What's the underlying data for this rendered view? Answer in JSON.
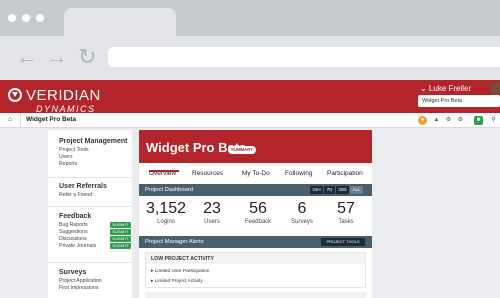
{
  "app": {
    "logo_line1": "VERIDIAN",
    "logo_line2": "DYNAMICS",
    "user_name": "⌄ Luke Freiler",
    "project_selector": "Widget Pro Beta"
  },
  "breadcrumb": {
    "home_icon": "⌂",
    "label": "Widget Pro Beta"
  },
  "toolbar": [
    "●",
    "▲",
    "⚙",
    "⚙",
    "■",
    "⚲"
  ],
  "sidebar": {
    "project_management": {
      "title": "Project Management",
      "items": [
        "Project Tools",
        "Users",
        "Reports"
      ]
    },
    "user_referrals": {
      "title": "User Referrals",
      "items": [
        "Refer a Friend"
      ]
    },
    "feedback": {
      "title": "Feedback",
      "items": [
        "Bug Reports",
        "Suggestions",
        "Discussions",
        "Private Journals"
      ],
      "submit_label": "SUBMIT"
    },
    "surveys": {
      "title": "Surveys",
      "items": [
        "Project Application",
        "First Impressions"
      ]
    }
  },
  "main": {
    "title": "Widget Pro Beta",
    "badge": "SUMMARY",
    "tabs": [
      "Overview",
      "Resources",
      "My To-Do",
      "Following",
      "Participation"
    ],
    "dashboard_label": "Project Dashboard",
    "ranges": [
      "24H",
      "7D",
      "30D",
      "ALL"
    ],
    "stats": [
      {
        "value": "3,152",
        "label": "Logins"
      },
      {
        "value": "23",
        "label": "Users"
      },
      {
        "value": "56",
        "label": "Feedback"
      },
      {
        "value": "6",
        "label": "Surveys"
      },
      {
        "value": "57",
        "label": "Tasks"
      }
    ],
    "alerts_label": "Project Manager Alerts",
    "project_tools": "PROJECT TOOLS",
    "low_activity_title": "LOW PROJECT ACTIVITY",
    "low_activity_items": [
      "▸  Limited User Participation",
      "▸  Limited Project Activity"
    ]
  },
  "colors": {
    "brand_red": "#b3252a",
    "dark_slate": "#48606e",
    "submit_green": "#2f9e4b"
  }
}
